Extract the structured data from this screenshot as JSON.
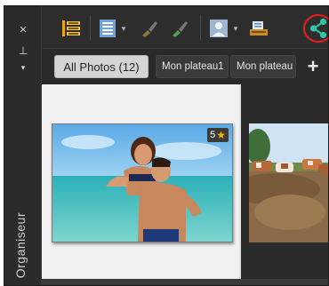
{
  "sidebar": {
    "close_glyph": "×",
    "pin_glyph": "⊥",
    "caret_glyph": "▾",
    "label": "Organiseur"
  },
  "toolbar": {
    "icons": [
      "layout-panels-icon",
      "list-view-icon",
      "brush-icon",
      "brush-alt-icon",
      "person-icon",
      "scanner-icon",
      "share-icon"
    ],
    "dropdown_glyph": "▾"
  },
  "tabs": {
    "items": [
      {
        "label": "All Photos (12)",
        "active": true
      },
      {
        "label": "Mon plateau1",
        "active": false
      },
      {
        "label": "Mon plateau",
        "active": false
      }
    ],
    "add_label": "+"
  },
  "thumbnails": [
    {
      "name": "beach-couple-photo",
      "rating": "5"
    },
    {
      "name": "cows-field-photo",
      "rating": ""
    }
  ],
  "colors": {
    "highlight_circle": "#d9201c",
    "share_icon": "#2fc6a8",
    "star": "#f2b200"
  }
}
